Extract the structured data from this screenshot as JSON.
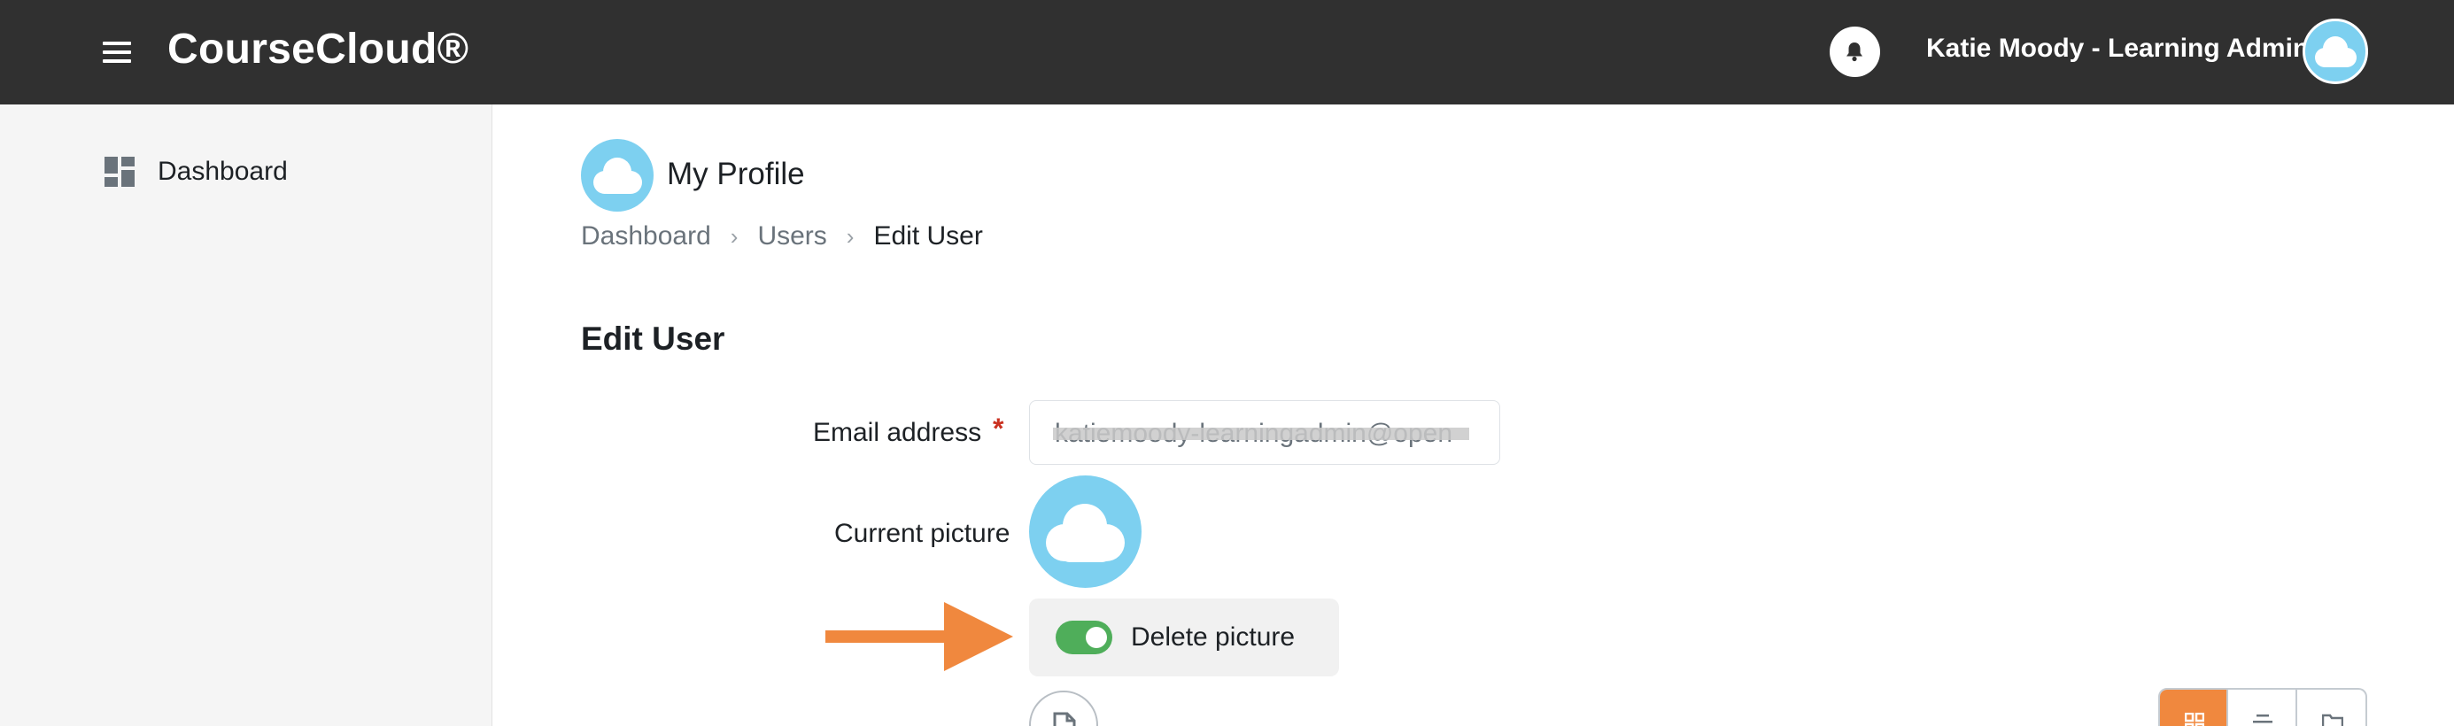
{
  "header": {
    "app_title": "CourseCloud®",
    "user_name": "Katie Moody - Learning Admin",
    "icons": {
      "menu": "hamburger-icon",
      "notifications": "bell-icon",
      "avatar": "cloud-avatar"
    }
  },
  "sidebar": {
    "items": [
      {
        "label": "Dashboard",
        "icon": "dashboard-grid-icon"
      }
    ]
  },
  "page": {
    "heading": "My Profile",
    "breadcrumb": [
      "Dashboard",
      "Users",
      "Edit User"
    ],
    "section_title": "Edit User"
  },
  "form": {
    "email_label": "Email address",
    "required_mark": "*",
    "email_value": "katiemoody-learningadmin@open",
    "current_picture_label": "Current picture",
    "delete_picture_label": "Delete picture",
    "delete_picture_on": true
  },
  "colors": {
    "header_bg": "#303030",
    "accent_orange": "#f0883e",
    "toggle_green": "#4fae5a",
    "avatar_blue": "#7dd0f0",
    "required_red": "#ca3120"
  }
}
